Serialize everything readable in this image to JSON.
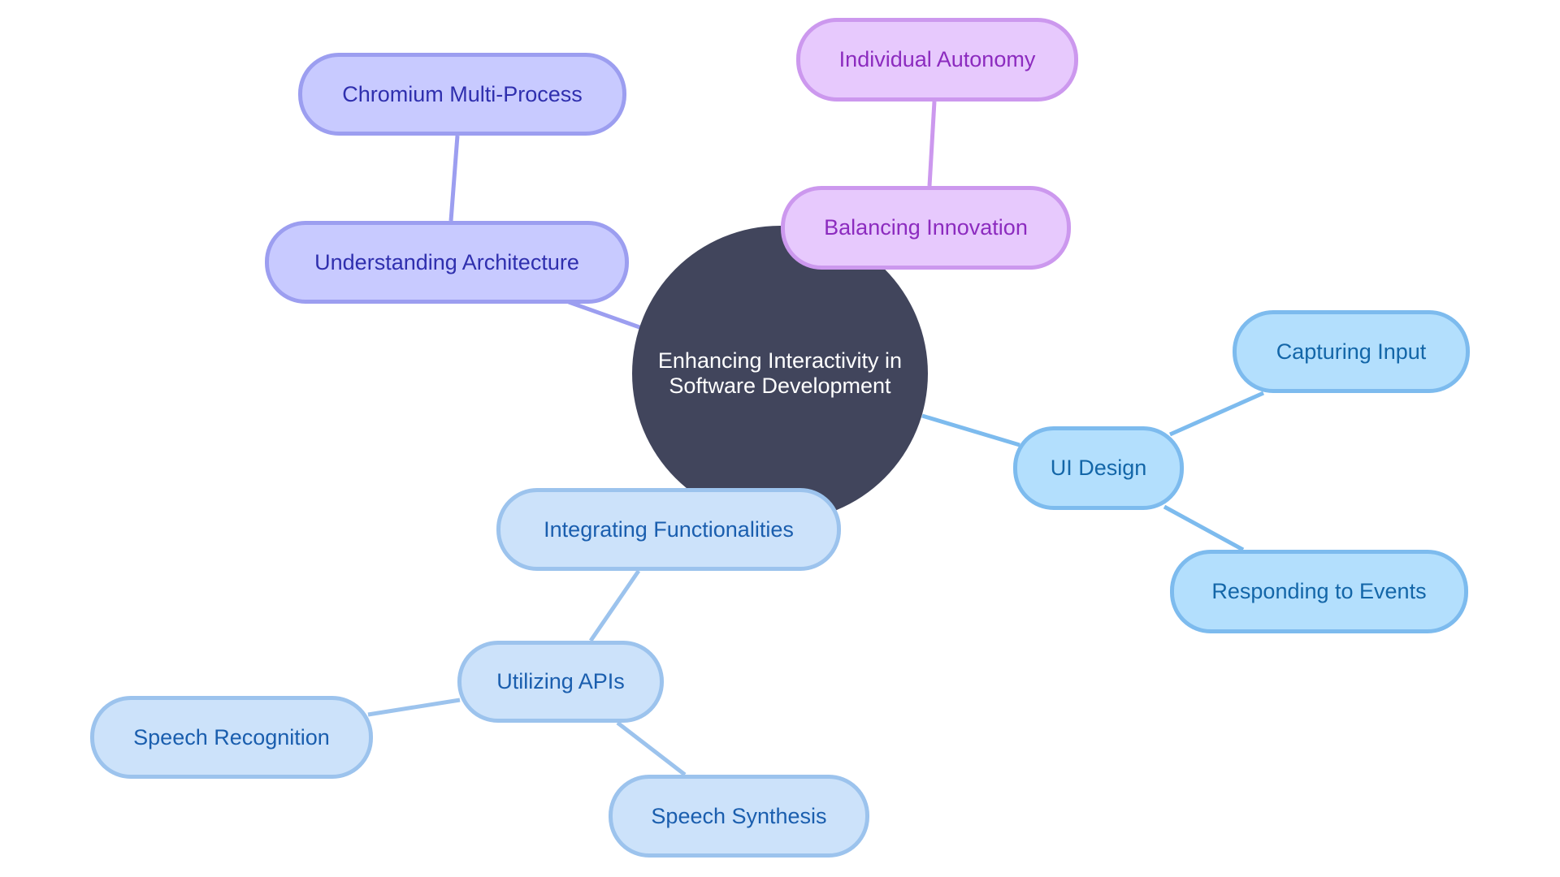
{
  "diagram": {
    "type": "mindmap",
    "root": {
      "id": "root",
      "label_line1": "Enhancing Interactivity in",
      "label_line2": "Software Development",
      "color": "#41455c"
    },
    "branches": [
      {
        "id": "arch",
        "label": "Understanding Architecture",
        "theme": "indigo",
        "parent": "root"
      },
      {
        "id": "chromium",
        "label": "Chromium Multi-Process",
        "theme": "indigo",
        "parent": "arch"
      },
      {
        "id": "balance",
        "label": "Balancing Innovation",
        "theme": "purple",
        "parent": "root"
      },
      {
        "id": "autonomy",
        "label": "Individual Autonomy",
        "theme": "purple",
        "parent": "balance"
      },
      {
        "id": "ui",
        "label": "UI Design",
        "theme": "sky",
        "parent": "root"
      },
      {
        "id": "capture",
        "label": "Capturing Input",
        "theme": "sky",
        "parent": "ui"
      },
      {
        "id": "respond",
        "label": "Responding to Events",
        "theme": "sky",
        "parent": "ui"
      },
      {
        "id": "integrate",
        "label": "Integrating Functionalities",
        "theme": "blue",
        "parent": "root"
      },
      {
        "id": "apis",
        "label": "Utilizing APIs",
        "theme": "blue",
        "parent": "integrate"
      },
      {
        "id": "recog",
        "label": "Speech Recognition",
        "theme": "blue",
        "parent": "apis"
      },
      {
        "id": "synth",
        "label": "Speech Synthesis",
        "theme": "blue",
        "parent": "apis"
      }
    ],
    "theme_colors": {
      "indigo": {
        "fill": "#c8caff",
        "stroke": "#9c9ef0",
        "text": "#2f2fae"
      },
      "purple": {
        "fill": "#e7c9fd",
        "stroke": "#cc98ee",
        "text": "#8c2bbf"
      },
      "sky": {
        "fill": "#b3dffd",
        "stroke": "#7dbbee",
        "text": "#1366a8"
      },
      "blue": {
        "fill": "#cce2fa",
        "stroke": "#9cc3ed",
        "text": "#1a5eae"
      }
    }
  }
}
